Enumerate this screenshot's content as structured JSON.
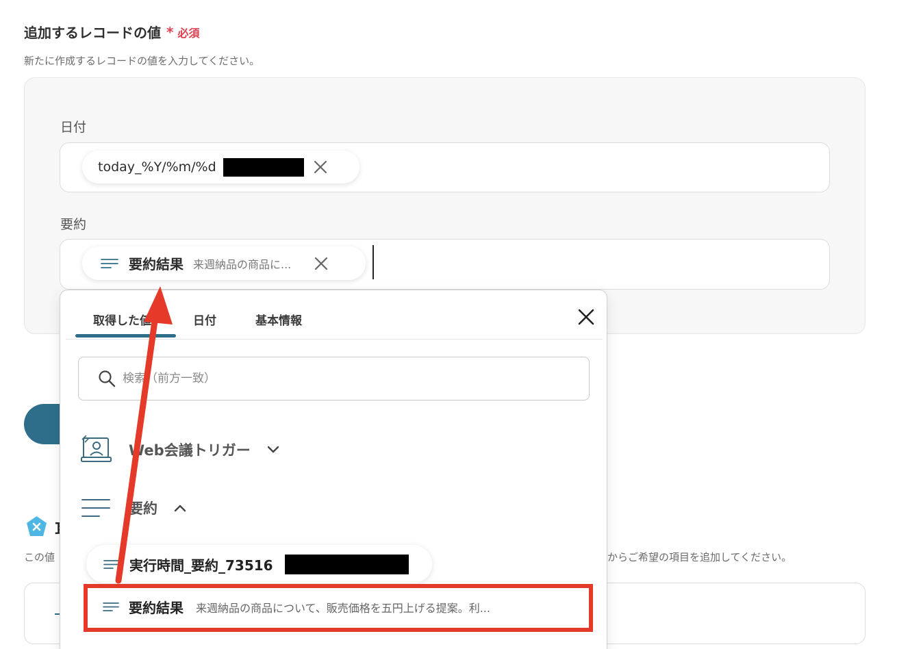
{
  "header": {
    "title": "追加するレコードの値",
    "required_star": "*",
    "required_label": "必須",
    "description": "新たに作成するレコードの値を入力してください。"
  },
  "fields": {
    "date": {
      "label": "日付",
      "chip_text": "today_%Y/%m/%d"
    },
    "summary": {
      "label": "要約",
      "chip_title": "要約結果",
      "chip_preview": "来週納品の商品に..."
    }
  },
  "dropdown": {
    "tabs": [
      "取得した値",
      "日付",
      "基本情報"
    ],
    "active_tab": 0,
    "search_placeholder": "検索（前方一致）",
    "groups": [
      {
        "label": "Web会議トリガー",
        "icon": "web-meeting-icon",
        "expanded": false
      },
      {
        "label": "要約",
        "icon": "text-lines-icon",
        "expanded": true
      }
    ],
    "items": [
      {
        "title": "実行時間_要約_73516",
        "preview": ""
      },
      {
        "title": "要約結果",
        "preview": "来週納品の商品について、販売価格を五円上げる提案。利..."
      }
    ]
  },
  "background": {
    "heading_partial": "耳",
    "desc_left": "この値",
    "desc_right": "からご希望の項目を追加してください。"
  },
  "colors": {
    "accent": "#2f6e8a",
    "required": "#e0404f",
    "annotation": "#e53a2a"
  }
}
